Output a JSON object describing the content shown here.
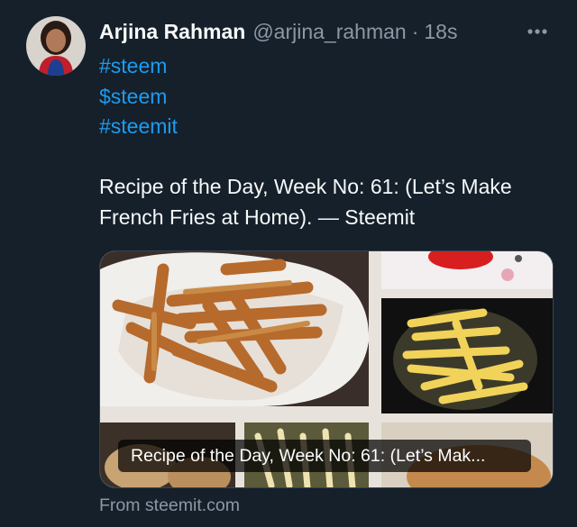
{
  "tweet": {
    "author_name": "Arjina Rahman",
    "author_handle": "@arjina_rahman",
    "separator": "·",
    "timestamp": "18s",
    "hashtags": [
      "#steem",
      "$steem",
      "#steemit"
    ],
    "text_line1": "Recipe of the Day, Week No: 61: (Let’s Make",
    "text_line2": "French Fries at Home). — Steemit"
  },
  "link_card": {
    "caption": "Recipe of the Day, Week No: 61: (Let’s Mak...",
    "source": "From steemit.com"
  },
  "icons": {
    "more": "more-horizontal-icon",
    "avatar": "profile-photo"
  },
  "colors": {
    "background": "#15202b",
    "link_blue": "#1d9bf0",
    "secondary_text": "#8b98a5",
    "primary_text": "#f7f9f9"
  }
}
